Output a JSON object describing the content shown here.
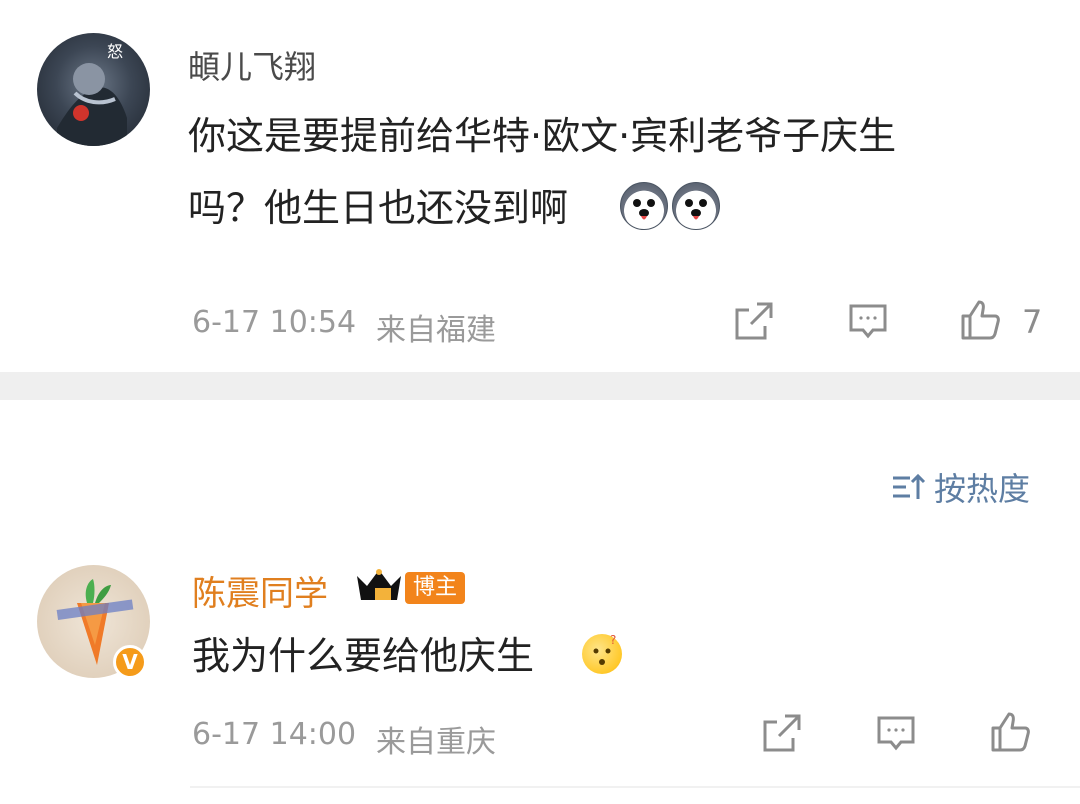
{
  "comments": [
    {
      "username": "頔儿飞翔",
      "text_line1": "你这是要提前给华特·欧文·宾利老爷子庆生",
      "text_line2": "吗？他生日也还没到啊",
      "emojis": [
        "husky-emoji",
        "husky-emoji"
      ],
      "time": "6-17 10:54",
      "location": "来自福建",
      "likes": "7"
    },
    {
      "username": "陈震同学",
      "badge": "博主",
      "verified_mark": "V",
      "text": "我为什么要给他庆生",
      "emoji": "thinking-emoji",
      "time": "6-17 14:00",
      "location": "来自重庆"
    }
  ],
  "sort": {
    "label": "按热度"
  },
  "colors": {
    "username_vip": "#e07f1f",
    "sort_text": "#5e7ea3",
    "separator": "#efefef"
  }
}
